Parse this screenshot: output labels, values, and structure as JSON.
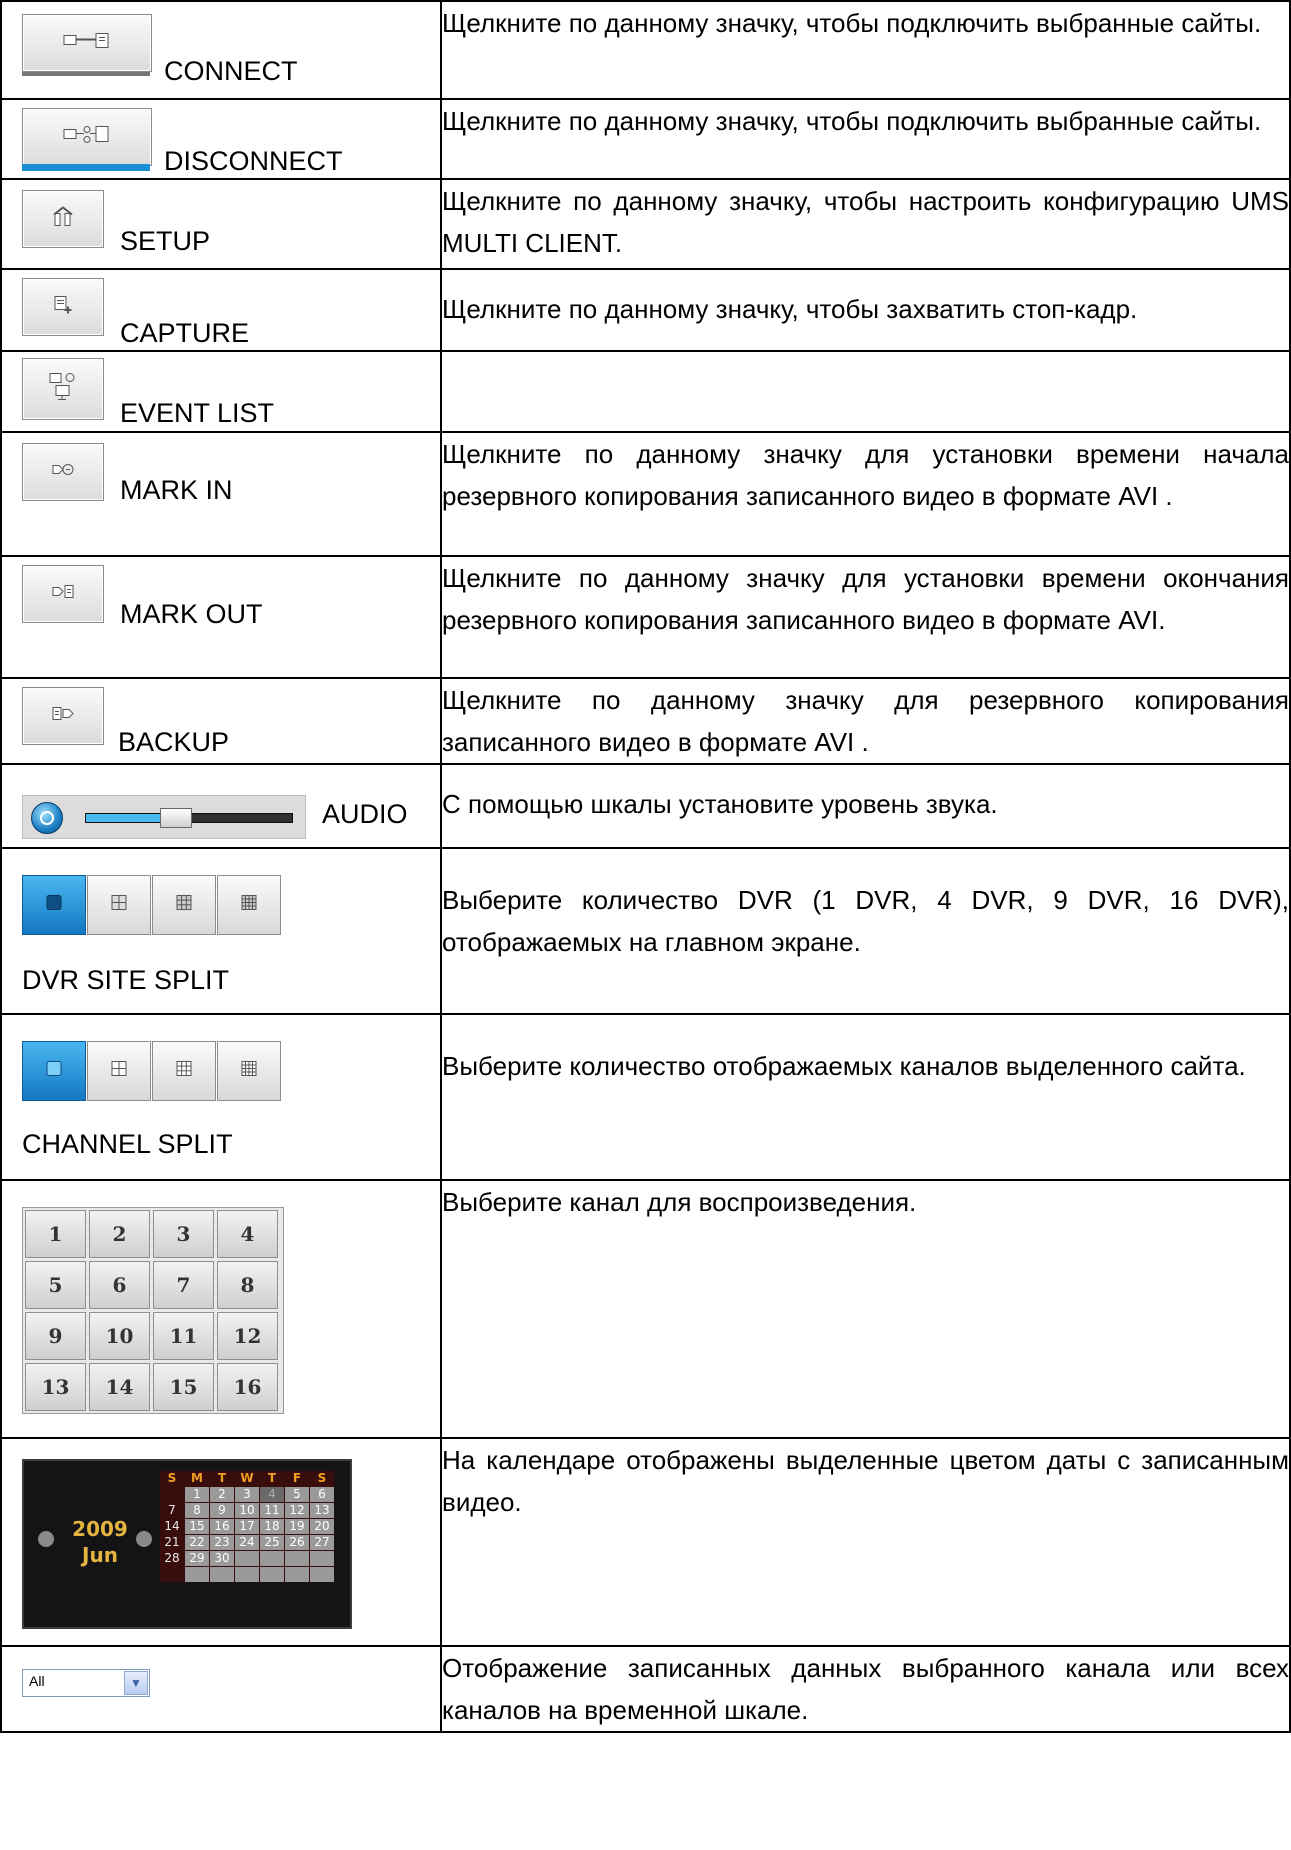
{
  "rows": [
    {
      "label": "CONNECT",
      "icon": "connect-icon",
      "desc": "Щелкните по данному значку, чтобы подключить выбранные сайты."
    },
    {
      "label": "DISCONNECT",
      "icon": "disconnect-icon",
      "desc": "Щелкните по данному значку, чтобы подключить выбранные сайты."
    },
    {
      "label": "SETUP",
      "icon": "setup-icon",
      "desc": "Щелкните по данному значку, чтобы настроить конфигурацию UMS MULTI CLIENT."
    },
    {
      "label": "CAPTURE",
      "icon": "capture-icon",
      "desc": "Щелкните по данному значку, чтобы захватить стоп-кадр."
    },
    {
      "label": "EVENT LIST",
      "icon": "event-list-icon",
      "desc": ""
    },
    {
      "label": "MARK IN",
      "icon": "mark-in-icon",
      "desc": "Щелкните по данному значку для установки времени начала резервного копирования записанного видео в формате AVI ."
    },
    {
      "label": "MARK OUT",
      "icon": "mark-out-icon",
      "desc": "Щелкните по данному значку для установки времени окончания резервного копирования записанного видео в формате AVI."
    },
    {
      "label": "BACKUP",
      "icon": "backup-icon",
      "desc": "Щелкните по данному значку для резервного копирования записанного видео в формате AVI ."
    },
    {
      "label": "AUDIO",
      "icon": "audio-icon",
      "desc": "С помощью шкалы установите уровень звука.",
      "level": 0.43
    },
    {
      "label": "DVR SITE SPLIT",
      "desc": "Выберите количество DVR (1 DVR, 4 DVR, 9 DVR, 16 DVR), отображаемых на главном экране."
    },
    {
      "label": "CHANNEL SPLIT",
      "desc": "Выберите количество отображаемых каналов выделенного сайта."
    },
    {
      "label": "",
      "desc": "Выберите канал для воспроизведения.",
      "channels": [
        "1",
        "2",
        "3",
        "4",
        "5",
        "6",
        "7",
        "8",
        "9",
        "10",
        "11",
        "12",
        "13",
        "14",
        "15",
        "16"
      ]
    },
    {
      "label": "",
      "desc": "На календаре отображены выделенные цветом даты с записанным видео."
    },
    {
      "label": "",
      "desc": "Отображение записанных данных выбранного канала или всех каналов на временной шкале."
    }
  ],
  "calendar": {
    "year": "2009",
    "month": "Jun",
    "weekdays": [
      "S",
      "M",
      "T",
      "W",
      "T",
      "F",
      "S"
    ],
    "weeks": [
      [
        "",
        "1",
        "2",
        "3",
        "4",
        "5",
        "6"
      ],
      [
        "7",
        "8",
        "9",
        "10",
        "11",
        "12",
        "13"
      ],
      [
        "14",
        "15",
        "16",
        "17",
        "18",
        "19",
        "20"
      ],
      [
        "21",
        "22",
        "23",
        "24",
        "25",
        "26",
        "27"
      ],
      [
        "28",
        "29",
        "30",
        "",
        "",
        "",
        ""
      ],
      [
        "",
        "",
        "",
        "",
        "",
        "",
        ""
      ]
    ]
  },
  "dropdown": {
    "value": "All"
  },
  "colors": {
    "accent": "#1b8fd6",
    "calendar_bg": "#141414",
    "calendar_text": "#e3b43f"
  }
}
